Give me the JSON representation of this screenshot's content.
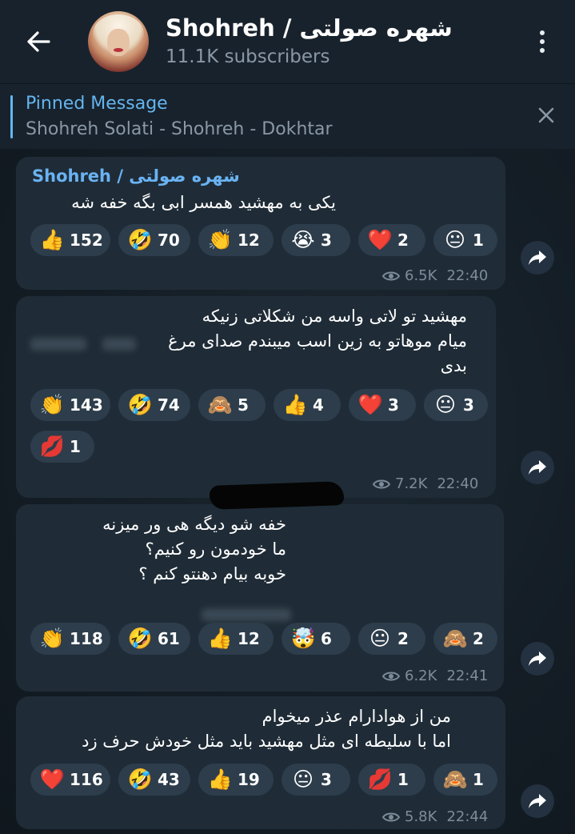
{
  "header": {
    "title": "Shohreh / شهره صولتی",
    "subtitle": "11.1K subscribers"
  },
  "pinned": {
    "title": "Pinned Message",
    "text": "Shohreh Solati - Shohreh - Dokhtar"
  },
  "messages": [
    {
      "sender": "Shohreh / شهره صولتی",
      "lines": [
        "یکی به مهشید همسر ابی بگه خفه شه"
      ],
      "reactions": [
        {
          "emoji": "👍",
          "count": "152"
        },
        {
          "emoji": "🤣",
          "count": "70"
        },
        {
          "emoji": "👏",
          "count": "12"
        },
        {
          "emoji": "😭",
          "count": "3"
        },
        {
          "emoji": "❤️",
          "count": "2"
        },
        {
          "emoji": "😐",
          "count": "1"
        }
      ],
      "views": "6.5K",
      "time": "22:40"
    },
    {
      "lines": [
        "مهشید تو لاتی واسه من شکلاتی زنیکه",
        "میام موهاتو به زین اسب میبندم صدای مرغ",
        "بدی"
      ],
      "reactions": [
        {
          "emoji": "👏",
          "count": "143"
        },
        {
          "emoji": "🤣",
          "count": "74"
        },
        {
          "emoji": "🙈",
          "count": "5"
        },
        {
          "emoji": "👍",
          "count": "4"
        },
        {
          "emoji": "❤️",
          "count": "3"
        },
        {
          "emoji": "😐",
          "count": "3"
        },
        {
          "emoji": "💋",
          "count": "1"
        }
      ],
      "views": "7.2K",
      "time": "22:40"
    },
    {
      "lines": [
        "خفه شو دیگه هی ور میزنه",
        "ما خودمون رو کنیم؟",
        "خوبه بیام دهنتو کنم ؟"
      ],
      "reactions": [
        {
          "emoji": "👏",
          "count": "118"
        },
        {
          "emoji": "🤣",
          "count": "61"
        },
        {
          "emoji": "👍",
          "count": "12"
        },
        {
          "emoji": "🤯",
          "count": "6"
        },
        {
          "emoji": "😐",
          "count": "2"
        },
        {
          "emoji": "🙈",
          "count": "2"
        }
      ],
      "views": "6.2K",
      "time": "22:41"
    },
    {
      "lines": [
        "من از هوادارام عذر میخوام",
        "اما با سلیطه ای مثل مهشید باید مثل خودش حرف زد"
      ],
      "reactions": [
        {
          "emoji": "❤️",
          "count": "116"
        },
        {
          "emoji": "🤣",
          "count": "43"
        },
        {
          "emoji": "👍",
          "count": "19"
        },
        {
          "emoji": "😐",
          "count": "3"
        },
        {
          "emoji": "💋",
          "count": "1"
        },
        {
          "emoji": "🙈",
          "count": "1"
        }
      ],
      "views": "5.8K",
      "time": "22:44"
    }
  ],
  "colors": {
    "header_bg": "#18222c",
    "bubble_bg": "#1f2c37",
    "accent": "#64b5ef",
    "reaction_bg": "#2d3d4b"
  },
  "icons": {
    "back": "arrow-left-icon",
    "menu": "more-vertical-icon",
    "close": "close-icon",
    "views": "eye-icon",
    "share": "share-arrow-icon"
  }
}
